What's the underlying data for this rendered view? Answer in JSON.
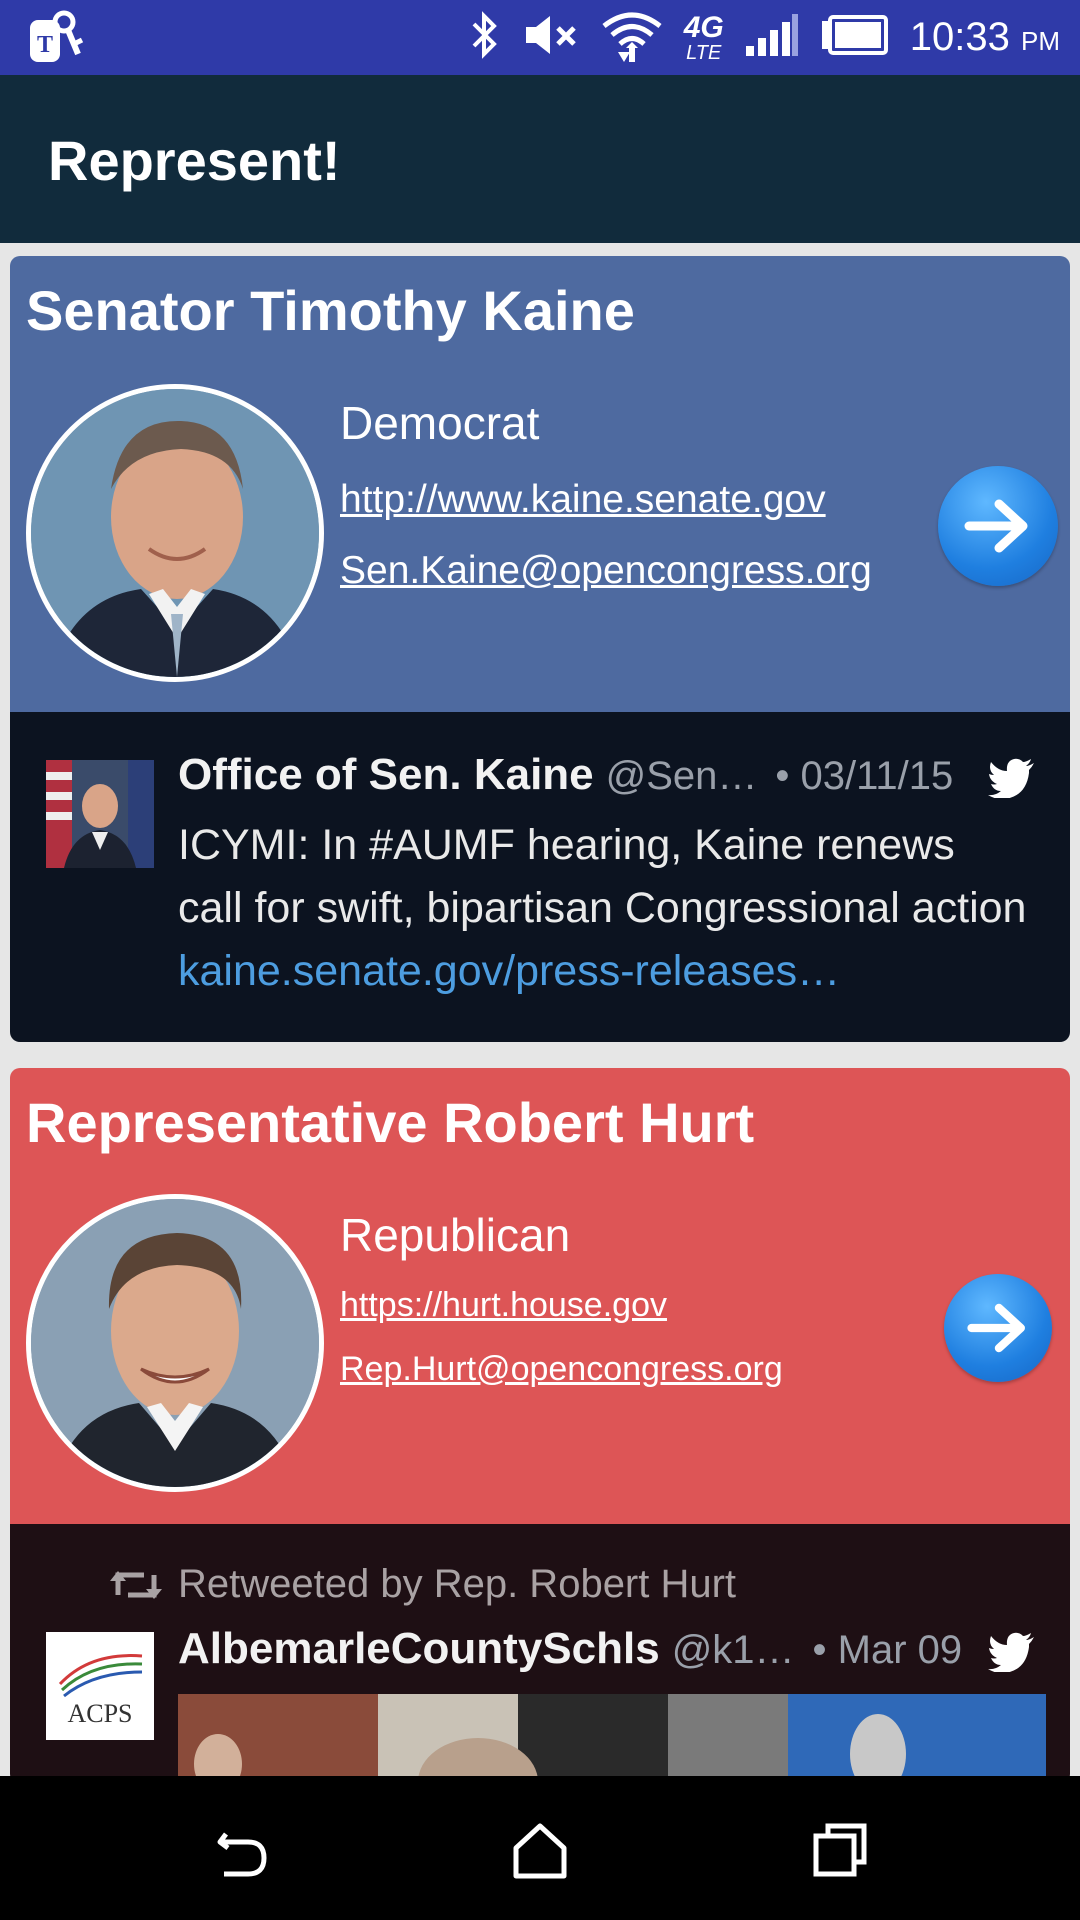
{
  "status_bar": {
    "time": "10:33",
    "ampm": "PM",
    "network": "4G",
    "network_sub": "LTE",
    "icons": [
      "carrier-key-icon",
      "bluetooth-icon",
      "volume-muted-icon",
      "wifi-icon",
      "signal-icon",
      "battery-icon"
    ]
  },
  "app_bar": {
    "title": "Represent!"
  },
  "cards": [
    {
      "title": "Senator",
      "name": "Timothy Kaine",
      "party": "Democrat",
      "website": "http://www.kaine.senate.gov",
      "email": "Sen.Kaine@opencongress.org",
      "color": "#4e6aa0",
      "tweet": {
        "author": "Office of Sen. Kaine",
        "handle": "@Sen…",
        "date": "• 03/11/15",
        "text": "ICYMI: In #AUMF hearing, Kaine renews call for swift, bipartisan Congressional action ",
        "link": "kaine.senate.gov/press-releases…"
      }
    },
    {
      "title": "Representative",
      "name": "Robert Hurt",
      "party": "Republican",
      "website": "https://hurt.house.gov",
      "email": "Rep.Hurt@opencongress.org",
      "color": "#dd5556",
      "tweet": {
        "retweeted_by": "Retweeted by Rep. Robert Hurt",
        "author": "AlbemarleCountySchls",
        "handle": "@k1…",
        "date": "• Mar 09",
        "avatar_text": "ACPS"
      }
    }
  ],
  "nav_bar": {
    "icons": [
      "back-icon",
      "home-icon",
      "recents-icon"
    ]
  }
}
